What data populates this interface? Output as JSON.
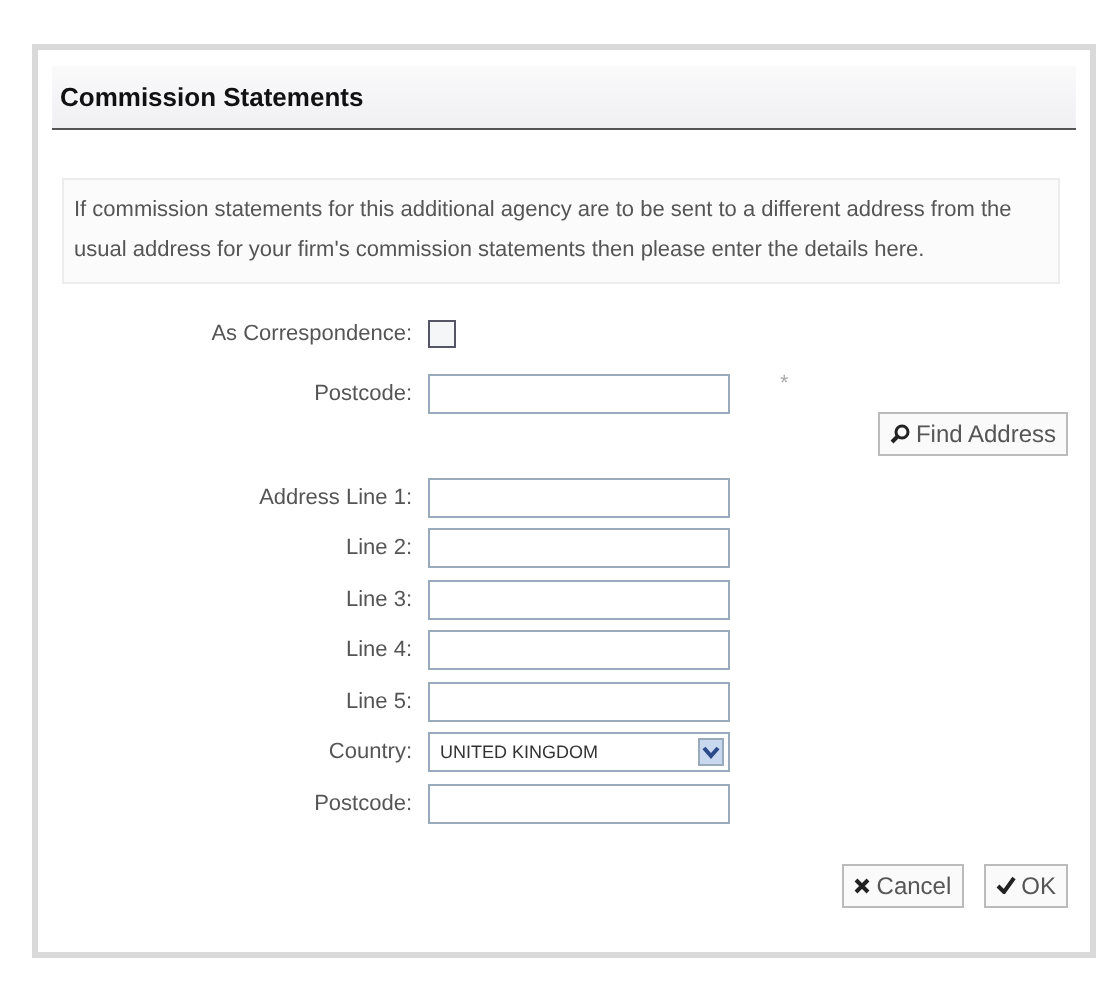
{
  "panel": {
    "title": "Commission Statements"
  },
  "info": "If commission statements for this additional agency are to be sent to a different address from the usual address for your firm's commission statements then please enter the details here.",
  "lookup_fields": [
    {
      "kind": "checkbox",
      "label": "As Correspondence:",
      "checked": false
    },
    {
      "kind": "text",
      "label": "Postcode:",
      "required_mark": "*"
    }
  ],
  "find_address_button": "Find Address",
  "address_fields": [
    {
      "kind": "text",
      "label": "Address Line 1:"
    },
    {
      "kind": "text",
      "label": "Line 2:"
    },
    {
      "kind": "text",
      "label": "Line 3:"
    },
    {
      "kind": "text",
      "label": "Line 4:"
    },
    {
      "kind": "text",
      "label": "Line 5:"
    },
    {
      "kind": "select",
      "label": "Country:",
      "value": "UNITED KINGDOM"
    },
    {
      "kind": "text",
      "label": "Postcode:"
    }
  ],
  "buttons": [
    {
      "kind": "cancel",
      "label": "Cancel"
    },
    {
      "kind": "ok",
      "label": "OK"
    }
  ]
}
